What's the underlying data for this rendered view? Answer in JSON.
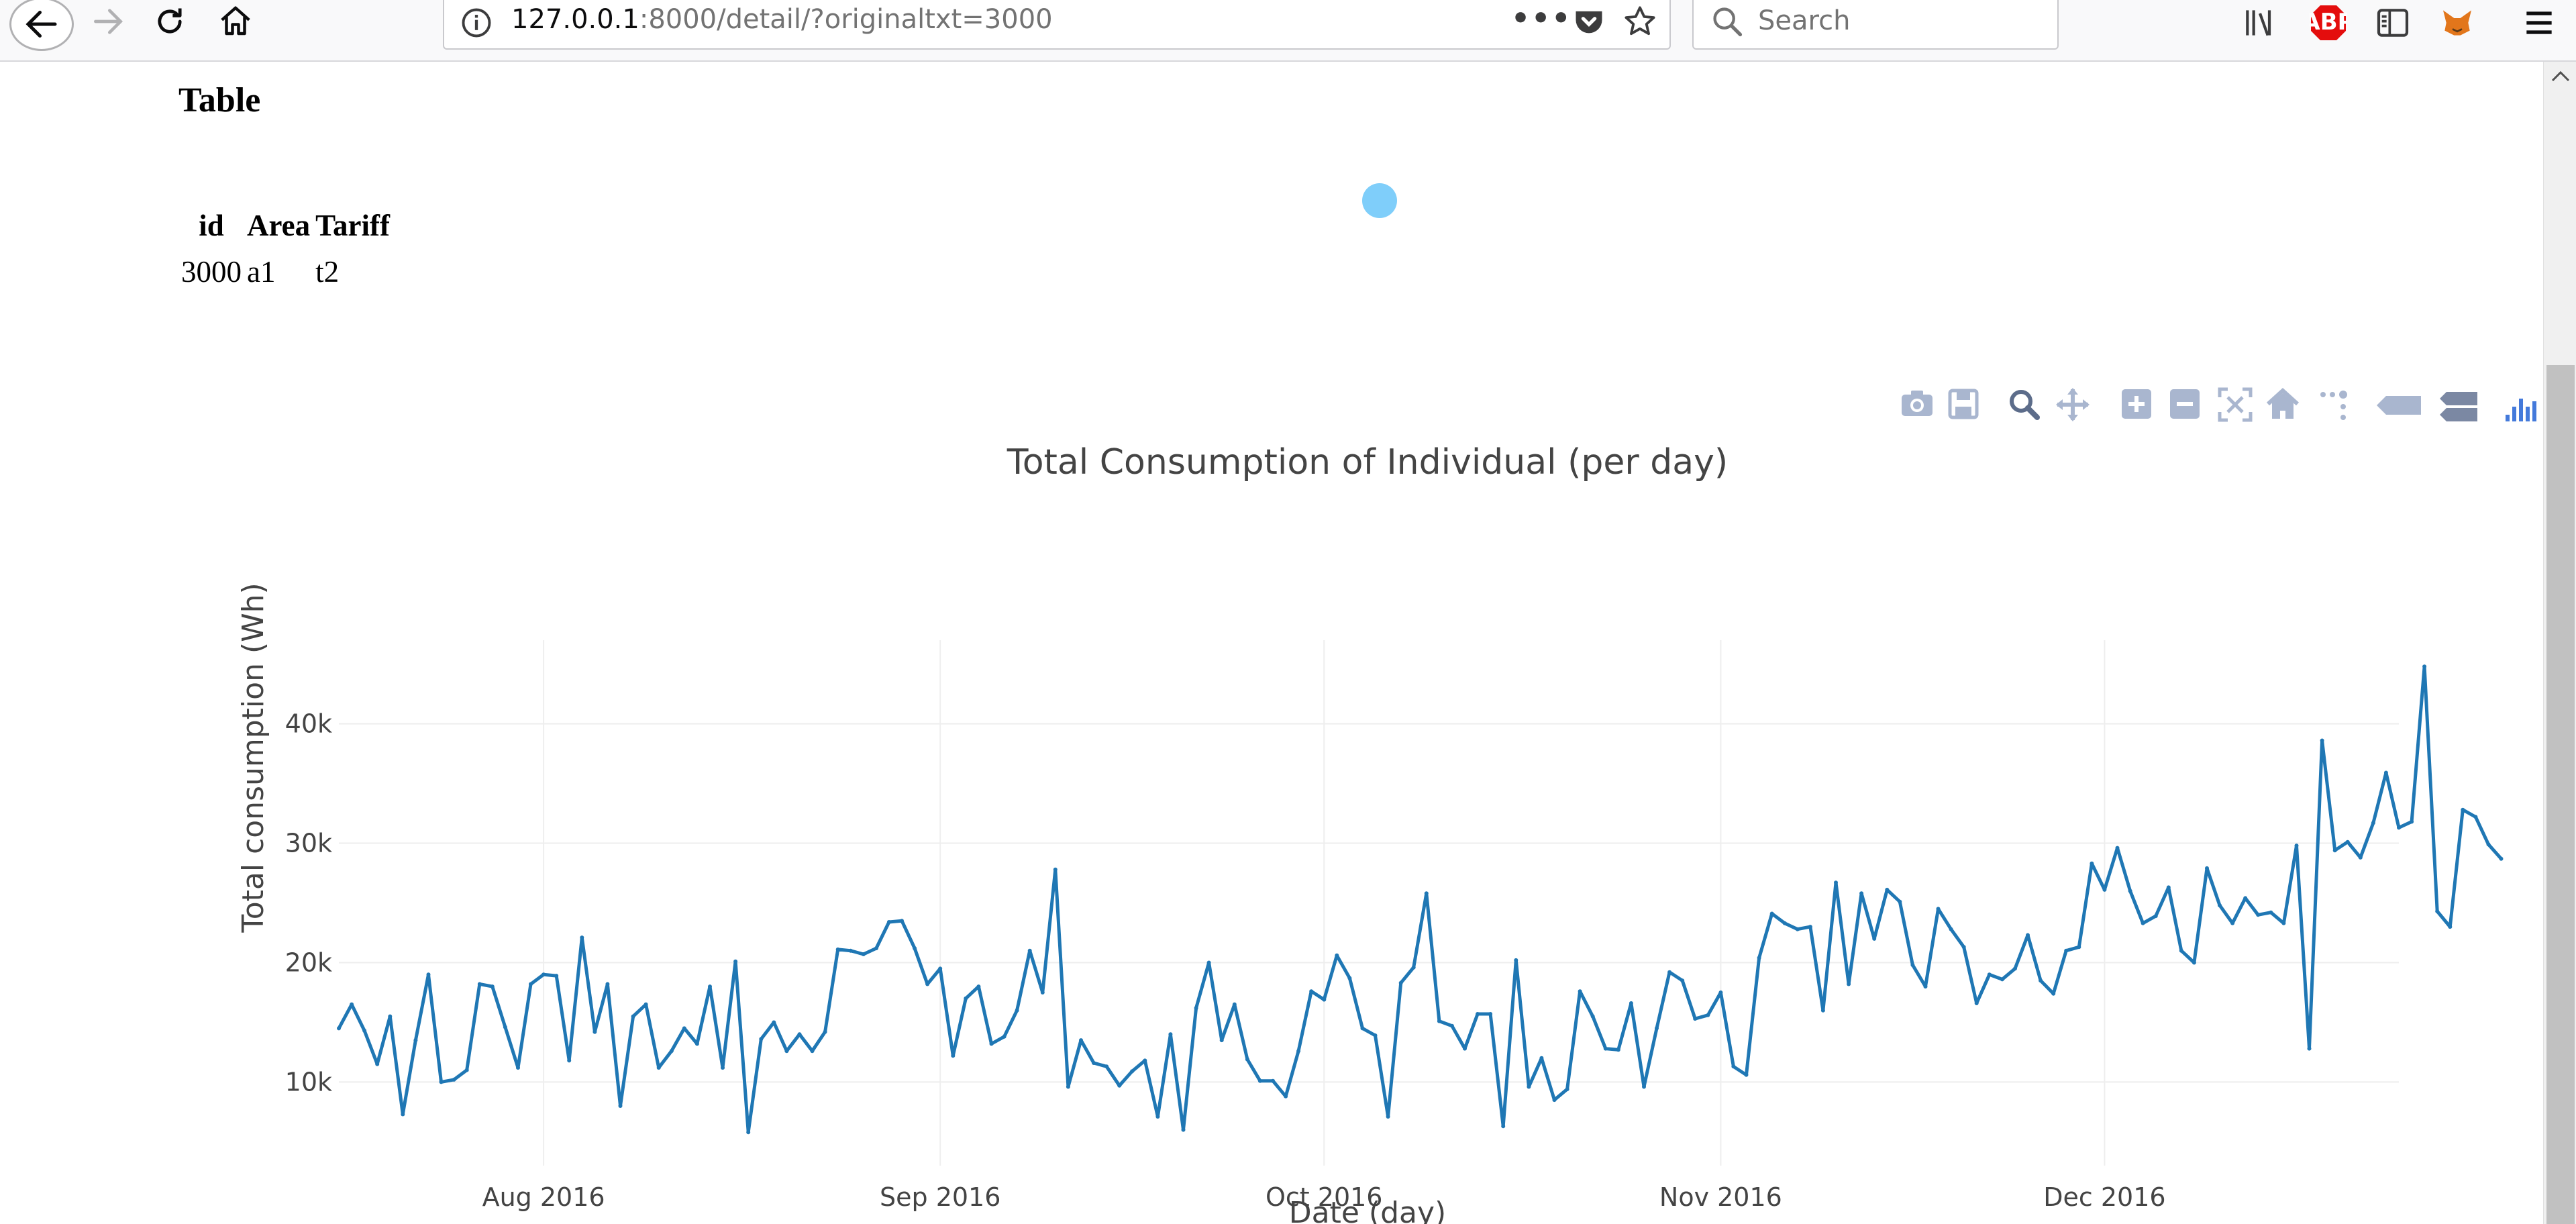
{
  "browser": {
    "url_host": "127.0.0.1",
    "url_path": ":8000/detail/?originaltxt=3000",
    "search_placeholder": "Search",
    "page_actions": "•••",
    "abp_label": "ABP"
  },
  "page": {
    "heading": "Table",
    "table": {
      "headers": [
        "id",
        "Area",
        "Tariff"
      ],
      "rows": [
        [
          "3000",
          "a1",
          "t2"
        ]
      ]
    }
  },
  "colors": {
    "line": "#1f77b4",
    "grid": "#eeeeee",
    "modebar": "#a9b6cf",
    "spinner": "#7fcefa"
  },
  "modebar_icons": [
    "camera-icon",
    "save-icon",
    "zoom-icon",
    "pan-icon",
    "zoom-in-icon",
    "zoom-out-icon",
    "autoscale-icon",
    "reset-axes-icon",
    "spike-lines-icon",
    "hover-closest-icon",
    "hover-compare-icon",
    "plotly-logo-icon"
  ],
  "chart_data": {
    "type": "line",
    "title": "Total Consumption of Individual (per day)",
    "xlabel": "Date (day)",
    "ylabel": "Total consumption (Wh)",
    "x_start": "2016-07-16",
    "x_end": "2016-12-24",
    "x_ticks": [
      {
        "date": "2016-08-01",
        "label": "Aug 2016"
      },
      {
        "date": "2016-09-01",
        "label": "Sep 2016"
      },
      {
        "date": "2016-10-01",
        "label": "Oct 2016"
      },
      {
        "date": "2016-11-01",
        "label": "Nov 2016"
      },
      {
        "date": "2016-12-01",
        "label": "Dec 2016"
      }
    ],
    "y_ticks": [
      {
        "value": 10000,
        "label": "10k"
      },
      {
        "value": 20000,
        "label": "20k"
      },
      {
        "value": 30000,
        "label": "30k"
      },
      {
        "value": 40000,
        "label": "40k"
      }
    ],
    "ylim": [
      3000,
      47000
    ],
    "grid": true,
    "series": [
      {
        "values": [
          14500,
          16500,
          14300,
          11500,
          15500,
          7300,
          13500,
          19000,
          10000,
          10200,
          11000,
          18200,
          18000,
          14600,
          11200,
          18200,
          19000,
          18900,
          11800,
          22100,
          14200,
          18200,
          8000,
          15500,
          16500,
          11200,
          12600,
          14500,
          13200,
          18000,
          11200,
          20100,
          5800,
          13600,
          15000,
          12600,
          14000,
          12600,
          14200,
          21100,
          21000,
          20700,
          21200,
          23400,
          23500,
          21200,
          18200,
          19500,
          12200,
          17000,
          18000,
          13200,
          13800,
          16000,
          21000,
          17500,
          27800,
          9600,
          13500,
          11600,
          11300,
          9700,
          10900,
          11800,
          7100,
          14000,
          6000,
          16200,
          20000,
          13500,
          16500,
          11900,
          10100,
          10100,
          8800,
          12600,
          17600,
          16900,
          20600,
          18700,
          14500,
          13900,
          7100,
          18300,
          19600,
          25800,
          15100,
          14700,
          12800,
          15700,
          15700,
          6300,
          20200,
          9600,
          12000,
          8500,
          9400,
          17600,
          15500,
          12800,
          12700,
          16600,
          9600,
          14500,
          19200,
          18500,
          15300,
          15600,
          17500,
          11300,
          10600,
          20400,
          24100,
          23300,
          22800,
          23000,
          16000,
          26700,
          18200,
          25800,
          22000,
          26100,
          25100,
          19800,
          18000,
          24500,
          22800,
          21300,
          16600,
          19000,
          18600,
          19500,
          22300,
          18500,
          17400,
          21000,
          21300,
          28300,
          26100,
          29600,
          26000,
          23300,
          23900,
          26300,
          21000,
          20000,
          27900,
          24800,
          23300,
          25400,
          24000,
          24200,
          23300,
          29800,
          12800,
          38600,
          29400,
          30100,
          28800,
          31700,
          35900,
          31300,
          31800,
          44800,
          24300,
          23000,
          32800,
          32200,
          29900,
          28700
        ]
      }
    ]
  }
}
